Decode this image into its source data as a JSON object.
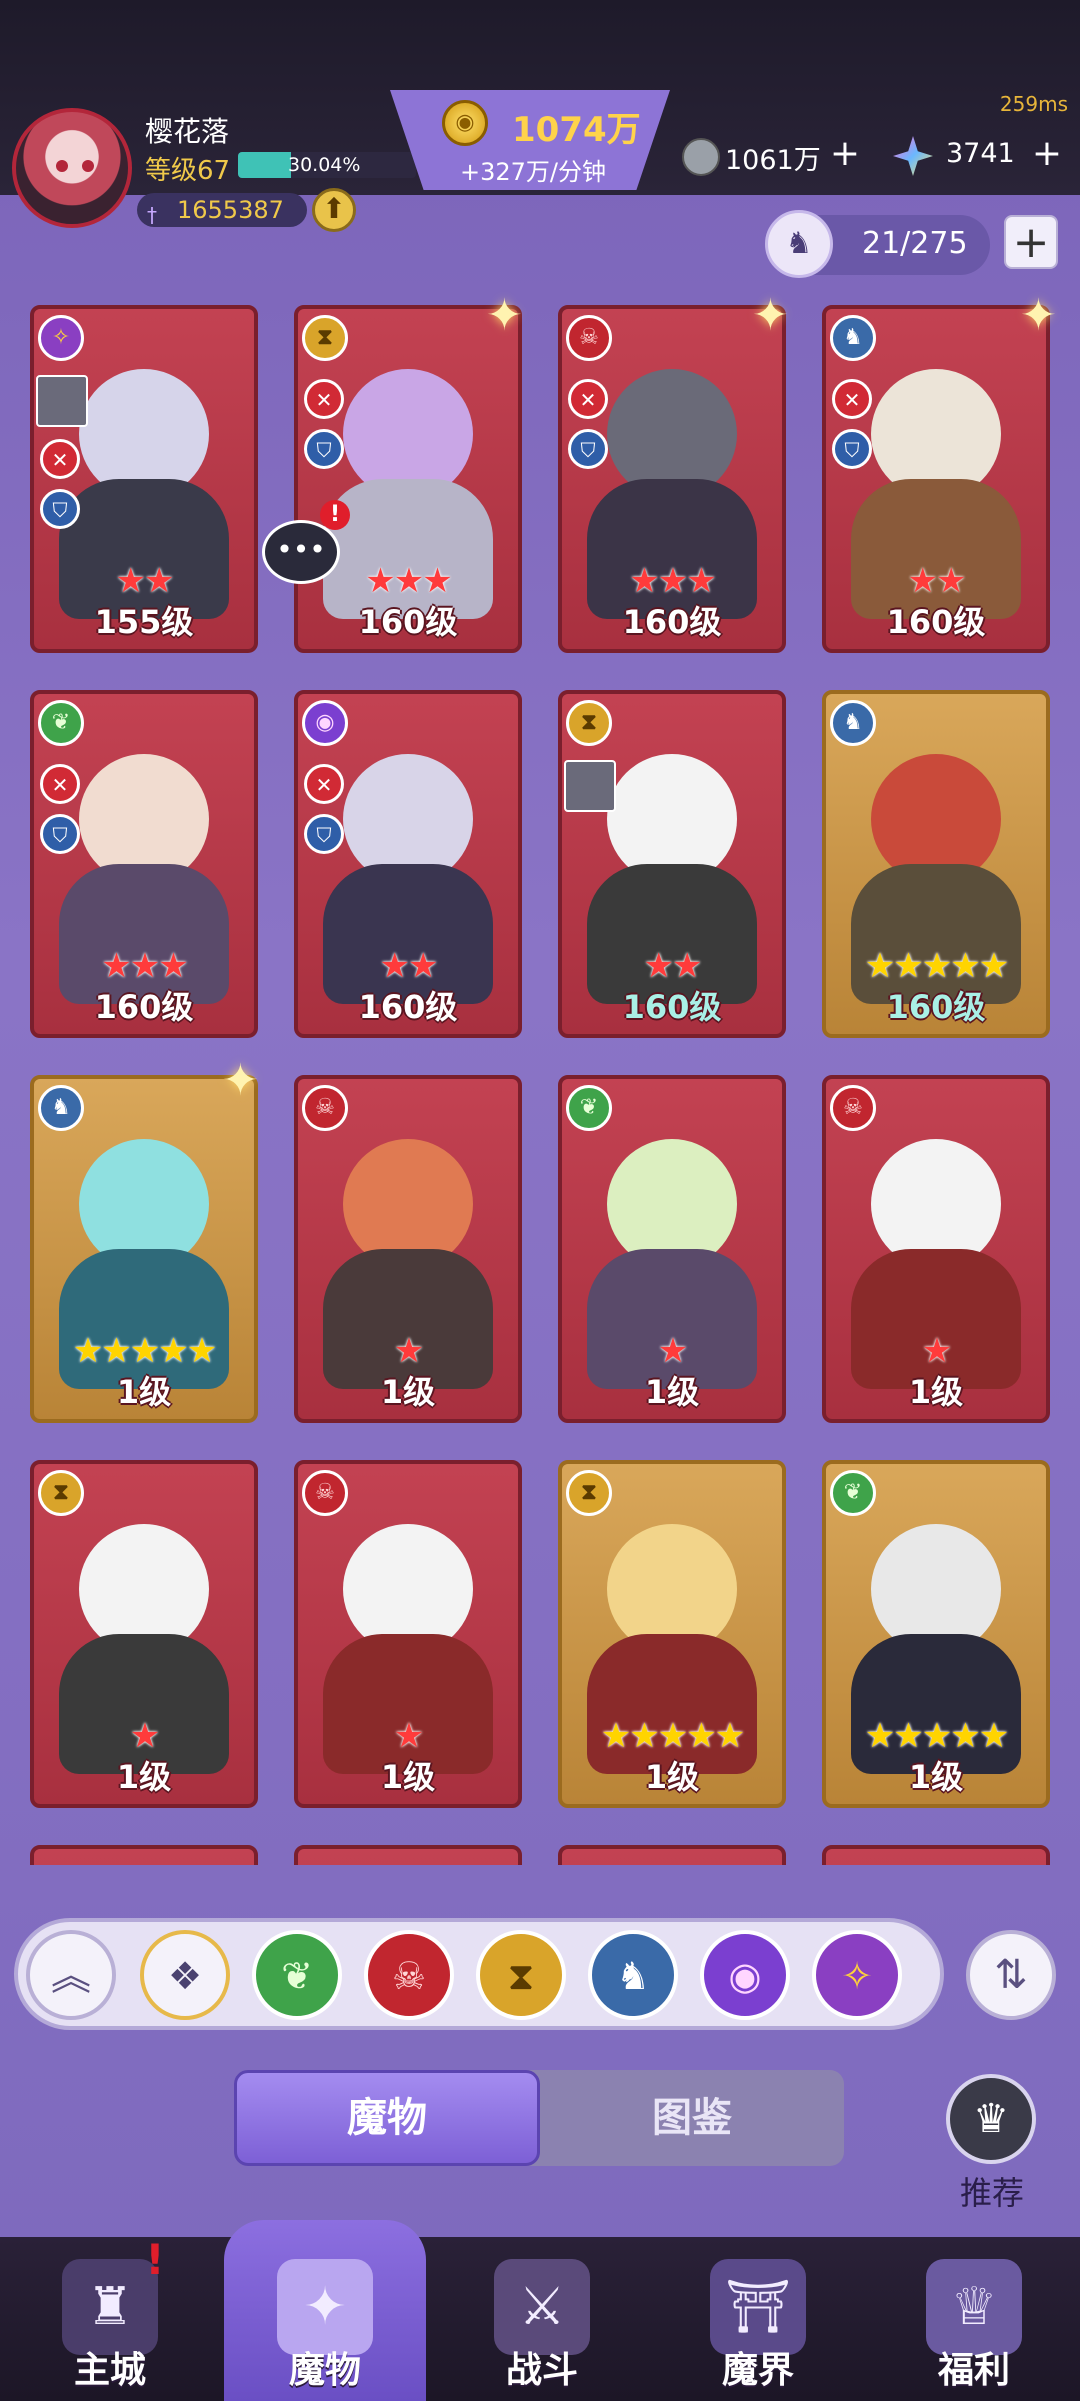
{
  "header": {
    "player_name": "樱花落",
    "player_level": "等级67",
    "xp_percent_text": "30.04%",
    "xp_fraction": 0.3004,
    "power": "1655387",
    "gold_value": "1074万",
    "gold_rate": "+327万/分钟",
    "ping": "259ms",
    "resource1_value": "1061万",
    "resource2_value": "3741",
    "plus_symbol": "+"
  },
  "storage": {
    "count": "21/275",
    "add_symbol": "+"
  },
  "cards": [
    {
      "level": "155级",
      "stars": "★★",
      "star_color": "red",
      "frame": "red",
      "faction": "rune-icon",
      "faction_glyph": "✧",
      "has_combat_icons": true,
      "accent": "#d6d4ea",
      "body": "#3a3a4a"
    },
    {
      "level": "160级",
      "stars": "★★★",
      "star_color": "red",
      "frame": "red",
      "faction": "sand-icon",
      "faction_glyph": "⧗",
      "has_combat_icons": true,
      "accent": "#c9a6e6",
      "body": "#b7b4c8"
    },
    {
      "level": "160级",
      "stars": "★★★",
      "star_color": "red",
      "frame": "red",
      "faction": "demon-icon",
      "faction_glyph": "☠",
      "has_combat_icons": true,
      "accent": "#6a6a78",
      "body": "#3b3447"
    },
    {
      "level": "160级",
      "stars": "★★",
      "star_color": "red",
      "frame": "red",
      "faction": "dragon-icon",
      "faction_glyph": "♞",
      "has_combat_icons": true,
      "accent": "#ece4d8",
      "body": "#8a5a3a"
    },
    {
      "level": "160级",
      "stars": "★★★",
      "star_color": "red",
      "frame": "red",
      "faction": "leaf-icon",
      "faction_glyph": "❦",
      "has_combat_icons": true,
      "accent": "#f1dcd0",
      "body": "#5a4a6a"
    },
    {
      "level": "160级",
      "stars": "★★",
      "star_color": "red",
      "frame": "red",
      "faction": "eye-icon",
      "faction_glyph": "◉",
      "has_combat_icons": true,
      "accent": "#d8d4e8",
      "body": "#3a3550"
    },
    {
      "level": "160级",
      "stars": "★★",
      "star_color": "red",
      "frame": "red",
      "faction": "sand-icon",
      "faction_glyph": "⧗",
      "has_combat_icons": false,
      "accent": "#f3f3f3",
      "body": "#3a3a3a",
      "level_color": "teal"
    },
    {
      "level": "160级",
      "stars": "★★★★★",
      "star_color": "yellow",
      "frame": "gold",
      "faction": "dragon-icon",
      "faction_glyph": "♞",
      "has_combat_icons": false,
      "accent": "#c94a3a",
      "body": "#5a4e3a",
      "level_color": "teal"
    },
    {
      "level": "1级",
      "stars": "★★★★★",
      "star_color": "yellow",
      "frame": "gold",
      "faction": "dragon-icon",
      "faction_glyph": "♞",
      "has_combat_icons": false,
      "accent": "#8fe0e0",
      "body": "#2f6a7a"
    },
    {
      "level": "1级",
      "stars": "★",
      "star_color": "red",
      "frame": "red",
      "faction": "demon-icon",
      "faction_glyph": "☠",
      "has_combat_icons": false,
      "accent": "#e07a52",
      "body": "#4a3a3a"
    },
    {
      "level": "1级",
      "stars": "★",
      "star_color": "red",
      "frame": "red",
      "faction": "leaf-icon",
      "faction_glyph": "❦",
      "has_combat_icons": false,
      "accent": "#dcefc0",
      "body": "#5a4a6a"
    },
    {
      "level": "1级",
      "stars": "★",
      "star_color": "red",
      "frame": "red",
      "faction": "demon-icon",
      "faction_glyph": "☠",
      "has_combat_icons": false,
      "accent": "#f3f3f3",
      "body": "#8a2a2a"
    },
    {
      "level": "1级",
      "stars": "★",
      "star_color": "red",
      "frame": "red",
      "faction": "sand-icon",
      "faction_glyph": "⧗",
      "has_combat_icons": false,
      "accent": "#f3f3f3",
      "body": "#3a3a3a"
    },
    {
      "level": "1级",
      "stars": "★",
      "star_color": "red",
      "frame": "red",
      "faction": "demon-icon",
      "faction_glyph": "☠",
      "has_combat_icons": false,
      "accent": "#f3f3f3",
      "body": "#8a2a2a"
    },
    {
      "level": "1级",
      "stars": "★★★★★",
      "star_color": "yellow",
      "frame": "gold",
      "faction": "sand-icon",
      "faction_glyph": "⧗",
      "has_combat_icons": false,
      "accent": "#f2d48a",
      "body": "#8a2a2a"
    },
    {
      "level": "1级",
      "stars": "★★★★★",
      "star_color": "yellow",
      "frame": "gold",
      "faction": "leaf-icon",
      "faction_glyph": "❦",
      "has_combat_icons": false,
      "accent": "#e8e8e8",
      "body": "#2a2a3a"
    }
  ],
  "filters": {
    "items": [
      "collapse-icon",
      "all-factions-icon",
      "leaf-faction-icon",
      "demon-faction-icon",
      "sand-faction-icon",
      "dragon-faction-icon",
      "eye-faction-icon",
      "rune-faction-icon"
    ]
  },
  "tabs": {
    "monsters": "魔物",
    "codex": "图鉴"
  },
  "recommend": {
    "label": "推荐"
  },
  "bottom_nav": [
    {
      "label": "主城",
      "icon": "castle-icon"
    },
    {
      "label": "魔物",
      "icon": "flame-icon"
    },
    {
      "label": "战斗",
      "icon": "sword-shield-icon"
    },
    {
      "label": "魔界",
      "icon": "portal-icon"
    },
    {
      "label": "福利",
      "icon": "gift-crown-icon"
    }
  ]
}
